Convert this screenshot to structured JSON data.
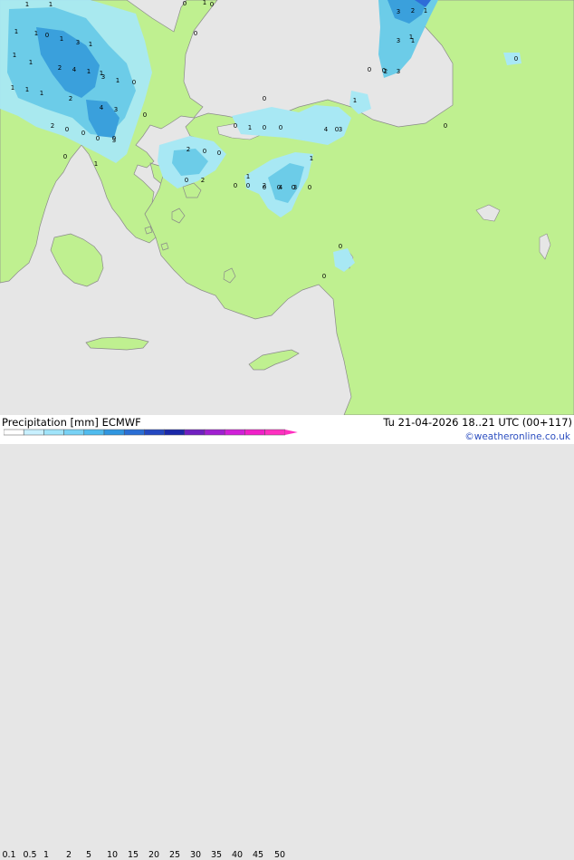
{
  "colors": {
    "sea": "#e6e6e6",
    "land": "#bff090",
    "coast": "#888888",
    "precip_light": "#a8e8f4",
    "precip_mid": "#6ccce8",
    "precip_heavy": "#3aa0dc",
    "precip_blue": "#2e6cd8"
  },
  "footer": {
    "title": "Precipitation [mm]",
    "model": "ECMWF",
    "valid_time": "Tu 21-04-2026 18..21 UTC (00+117)",
    "credit": "©weatheronline.co.uk",
    "scale_ticks": [
      "0.1",
      "0.5",
      "1",
      "2",
      "5",
      "10",
      "15",
      "20",
      "25",
      "30",
      "35",
      "40",
      "45",
      "50"
    ],
    "scale_colors": [
      "#ffffff",
      "#c8f0ff",
      "#a0e4fa",
      "#78d2f5",
      "#50bcee",
      "#3096e0",
      "#2a6ed4",
      "#2448c0",
      "#1a28a8",
      "#7020c0",
      "#a020d0",
      "#d020d8",
      "#f020c8",
      "#ff30c0"
    ]
  },
  "map_values": [
    {
      "v": "1"
    },
    {
      "v": "1"
    },
    {
      "v": "0"
    },
    {
      "v": "1"
    },
    {
      "v": "0"
    },
    {
      "v": "3"
    },
    {
      "v": "2"
    },
    {
      "v": "1"
    },
    {
      "v": "1"
    },
    {
      "v": "1"
    },
    {
      "v": "0"
    },
    {
      "v": "1"
    },
    {
      "v": "3"
    },
    {
      "v": "1"
    },
    {
      "v": "2"
    },
    {
      "v": "4"
    },
    {
      "v": "1"
    },
    {
      "v": "1"
    },
    {
      "v": "3"
    },
    {
      "v": "1"
    },
    {
      "v": "0"
    },
    {
      "v": "1"
    },
    {
      "v": "1"
    },
    {
      "v": "1"
    },
    {
      "v": "1"
    },
    {
      "v": "1"
    },
    {
      "v": "2"
    },
    {
      "v": "4"
    },
    {
      "v": "3"
    },
    {
      "v": "0"
    },
    {
      "v": "2"
    },
    {
      "v": "0"
    },
    {
      "v": "0"
    },
    {
      "v": "0"
    },
    {
      "v": "0"
    },
    {
      "v": "3"
    },
    {
      "v": "0"
    },
    {
      "v": "1"
    },
    {
      "v": "0"
    },
    {
      "v": "0"
    },
    {
      "v": "1"
    },
    {
      "v": "0"
    },
    {
      "v": "0"
    },
    {
      "v": "3"
    },
    {
      "v": "2"
    },
    {
      "v": "1"
    },
    {
      "v": "3"
    },
    {
      "v": "1"
    },
    {
      "v": "0"
    },
    {
      "v": "2"
    },
    {
      "v": "0"
    },
    {
      "v": "0"
    },
    {
      "v": "1"
    },
    {
      "v": "0"
    },
    {
      "v": "0"
    },
    {
      "v": "1"
    },
    {
      "v": "0"
    },
    {
      "v": "4"
    },
    {
      "v": "3"
    },
    {
      "v": "0"
    },
    {
      "v": "0"
    },
    {
      "v": "2"
    },
    {
      "v": "0"
    },
    {
      "v": "1"
    },
    {
      "v": "0"
    },
    {
      "v": "2"
    },
    {
      "v": "0"
    },
    {
      "v": "0"
    },
    {
      "v": "0"
    },
    {
      "v": "0"
    },
    {
      "v": "4"
    },
    {
      "v": "3"
    },
    {
      "v": "0"
    },
    {
      "v": "0"
    },
    {
      "v": "0"
    }
  ]
}
